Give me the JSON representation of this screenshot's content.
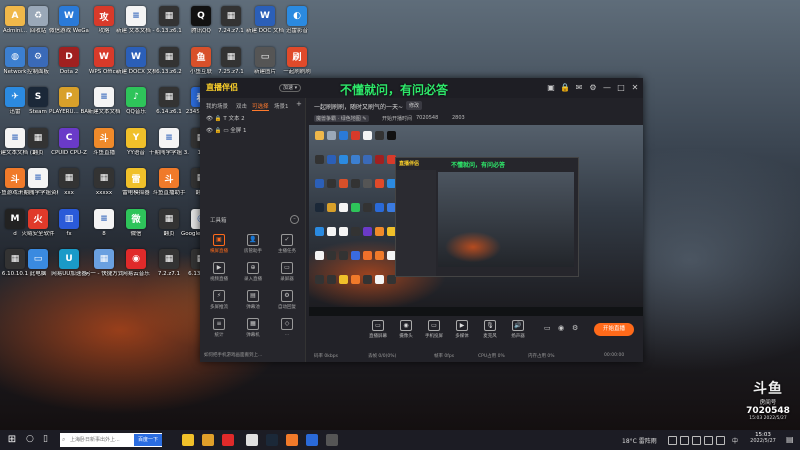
{
  "desktop": {
    "icons": [
      {
        "label": "Admini...",
        "color": "#f0b84a",
        "glyph": "A"
      },
      {
        "label": "回收站",
        "color": "#9aa8b8",
        "glyph": "♻"
      },
      {
        "label": "微信游戏\nWeGame版",
        "color": "#2a7ad8",
        "glyph": "W"
      },
      {
        "label": "攻略",
        "color": "#d83a2a",
        "glyph": "攻"
      },
      {
        "label": "新建 文本文档 - 副本",
        "color": "#f4f4f4",
        "glyph": "≡"
      },
      {
        "label": "6.13.z6.1",
        "color": "#333",
        "glyph": "▦"
      },
      {
        "label": "腾讯QQ",
        "color": "#111",
        "glyph": "Q"
      },
      {
        "label": "7.24.z7.1",
        "color": "#333",
        "glyph": "▦"
      },
      {
        "label": "新建 DOC 文档",
        "color": "#2b5fb8",
        "glyph": "W"
      },
      {
        "label": "迅雷影音",
        "color": "#2b8ae0",
        "glyph": "◐"
      },
      {
        "label": "Network",
        "color": "#3c7fd0",
        "glyph": "◍"
      },
      {
        "label": "控制面板",
        "color": "#3a6ab8",
        "glyph": "⚙"
      },
      {
        "label": "Dota 2",
        "color": "#a02020",
        "glyph": "D"
      },
      {
        "label": "WPS Office",
        "color": "#d83a2a",
        "glyph": "W"
      },
      {
        "label": "新建 DOCX 文档",
        "color": "#2b5fb8",
        "glyph": "W"
      },
      {
        "label": "6.13.z6.2",
        "color": "#333",
        "glyph": "▦"
      },
      {
        "label": "小鱼互联",
        "color": "#d8502a",
        "glyph": "鱼"
      },
      {
        "label": "7.25.z7.1",
        "color": "#333",
        "glyph": "▦"
      },
      {
        "label": "新建图片",
        "color": "#555",
        "glyph": "▭"
      },
      {
        "label": "一起刷刷刷",
        "color": "#e04a2a",
        "glyph": "刷"
      },
      {
        "label": "迅雷",
        "color": "#2b8ae0",
        "glyph": "✈"
      },
      {
        "label": "Steam",
        "color": "#1b2838",
        "glyph": "S"
      },
      {
        "label": "PLAYERU... BATTLEGR...",
        "color": "#d8a02a",
        "glyph": "P"
      },
      {
        "label": "新建文本文档",
        "color": "#f4f4f4",
        "glyph": "≡"
      },
      {
        "label": "QQ音乐",
        "color": "#2ec45a",
        "glyph": "♪"
      },
      {
        "label": "6.14.z6.1",
        "color": "#333",
        "glyph": "▦"
      },
      {
        "label": "2345看图王",
        "color": "#2a6ad8",
        "glyph": "看"
      },
      {
        "label": "斗鱼直播伴侣",
        "color": "#3a7ae0",
        "glyph": "斗"
      },
      {
        "label": "QQ游戏",
        "color": "#2a8ae0",
        "glyph": "游"
      },
      {
        "label": "十期闯学学姐",
        "color": "#f4f4f4",
        "glyph": "≡"
      },
      {
        "label": "新建文本文档 (2)",
        "color": "#f4f4f4",
        "glyph": "≡"
      },
      {
        "label": "翻页",
        "color": "#333",
        "glyph": "▦"
      },
      {
        "label": "CPUID CPU-Z",
        "color": "#6a3ac8",
        "glyph": "C"
      },
      {
        "label": "斗鱼直播",
        "color": "#f08a2a",
        "glyph": "斗"
      },
      {
        "label": "YY语音",
        "color": "#f0c02a",
        "glyph": "Y"
      },
      {
        "label": "十期闯学学姐 3.15日期表",
        "color": "#f4f4f4",
        "glyph": "≡"
      },
      {
        "label": "10",
        "color": "#333",
        "glyph": "▦"
      },
      {
        "label": "翻页",
        "color": "#333",
        "glyph": "▦"
      },
      {
        "label": "雷电多开器",
        "color": "#3a6ae0",
        "glyph": "雷"
      },
      {
        "label": "斗鱼直播伴侣",
        "color": "#f0702a",
        "glyph": "斗"
      },
      {
        "label": "斗鱼游戏浏览器",
        "color": "#f07a2a",
        "glyph": "斗"
      },
      {
        "label": "十期闯学学姐资料",
        "color": "#f4f4f4",
        "glyph": "≡"
      },
      {
        "label": "xxx",
        "color": "#333",
        "glyph": "▦"
      },
      {
        "label": "xxxxx",
        "color": "#333",
        "glyph": "▦"
      },
      {
        "label": "雷电模拟器",
        "color": "#f0c02a",
        "glyph": "雷"
      },
      {
        "label": "斗鱼直播助手",
        "color": "#f07a2a",
        "glyph": "斗"
      },
      {
        "label": "翻页",
        "color": "#333",
        "glyph": "▦"
      },
      {
        "label": "资源",
        "color": "#f4f4f4",
        "glyph": "≡"
      },
      {
        "label": "xl",
        "color": "#333",
        "glyph": "▦"
      },
      {
        "label": "翻页",
        "color": "#333",
        "glyph": "▦"
      },
      {
        "label": "d",
        "color": "#222",
        "glyph": "M"
      },
      {
        "label": "火绒安全软件",
        "color": "#e03a2a",
        "glyph": "火"
      },
      {
        "label": "fx",
        "color": "#2a5ad8",
        "glyph": "▥"
      },
      {
        "label": "8",
        "color": "#f4f4f4",
        "glyph": "≡"
      },
      {
        "label": "微信",
        "color": "#2ec45a",
        "glyph": "微"
      },
      {
        "label": "翻页",
        "color": "#333",
        "glyph": "▦"
      },
      {
        "label": "Google Chrome",
        "color": "#e0e0e0",
        "glyph": "◎"
      },
      {
        "label": "魔兽争霸官方对战平台",
        "color": "#2a4ad8",
        "glyph": "魔"
      },
      {
        "label": "赛博朋克 2077",
        "color": "#f0e02a",
        "glyph": "C"
      },
      {
        "label": "新建文本文档",
        "color": "#f4f4f4",
        "glyph": "≡"
      },
      {
        "label": "6.10.10.1",
        "color": "#333",
        "glyph": "▦"
      },
      {
        "label": "此电脑",
        "color": "#3a8ae0",
        "glyph": "▭"
      },
      {
        "label": "网易UU加速器",
        "color": "#1a9ac8",
        "glyph": "U"
      },
      {
        "label": "另一 - 快捷方式",
        "color": "#6aa0e0",
        "glyph": "▦"
      },
      {
        "label": "网易云音乐",
        "color": "#e02a2a",
        "glyph": "◉"
      },
      {
        "label": "7.2.z7.1",
        "color": "#333",
        "glyph": "▦"
      },
      {
        "label": "6.13.z6.1",
        "color": "#333",
        "glyph": "▦"
      },
      {
        "label": "b.2/9.z6",
        "color": "#333",
        "glyph": "▦"
      }
    ]
  },
  "app": {
    "logo": "直播伴侣",
    "logo_badge": "加速 ▾",
    "overlay_title": "不懂就问，有问必答",
    "window_controls": {
      "min": "—",
      "max": "□",
      "close": "✕",
      "settings": "⚙",
      "mail": "✉",
      "shirt": "▣",
      "lock": "🔒"
    },
    "sidebar": {
      "tabs": [
        "我的场景",
        "双击",
        "可选择",
        "场景1",
        "+"
      ],
      "active_tab": 2,
      "scenes": [
        {
          "label": "文本 2",
          "icons": "👁 🔒 T"
        },
        {
          "label": "全屏 1",
          "icons": "👁 🔒 ▭"
        }
      ],
      "tools_heading": "工具箱",
      "tools": [
        {
          "label": "横屏直播",
          "icon": "▣",
          "active": true
        },
        {
          "label": "房管助手",
          "icon": "👤"
        },
        {
          "label": "主播任务",
          "icon": "✓"
        },
        {
          "label": "视频直播",
          "icon": "▶"
        },
        {
          "label": "录入直播",
          "icon": "⊕"
        },
        {
          "label": "录屏器",
          "icon": "▭"
        },
        {
          "label": "多屏推流",
          "icon": "⚡"
        },
        {
          "label": "弹幕池",
          "icon": "▤"
        },
        {
          "label": "自动回复",
          "icon": "⚙"
        },
        {
          "label": "统计",
          "icon": "≡"
        },
        {
          "label": "弹幕机",
          "icon": "▦"
        },
        {
          "label": "...",
          "icon": "◇"
        }
      ],
      "tip": "如何把手机游戏画面搬到上..."
    },
    "room": {
      "title": "一起刷刷刷，随时又刷气的一天~",
      "edit_label": "修改",
      "info": [
        "魔兽争霸 · 绿色地图 ✎",
        "开始开播时间",
        "7020548",
        "2803"
      ]
    },
    "inner": {
      "title": "不懂就问，有问必答",
      "logo": "直播伴侣"
    },
    "bottom_tools": [
      {
        "label": "直播屏幕",
        "icon": "▭"
      },
      {
        "label": "摄像头",
        "icon": "◉"
      },
      {
        "label": "手机投屏",
        "icon": "▭"
      },
      {
        "label": "多媒体",
        "icon": "▶"
      },
      {
        "label": "麦克风",
        "icon": "🎙"
      },
      {
        "label": "扬声器",
        "icon": "🔊"
      }
    ],
    "right_icons": {
      "record": "▭",
      "eye": "◉",
      "settings": "⚙"
    },
    "start_live": "开始直播",
    "status": [
      "码率 0kbps",
      "丢帧 0/0(0%)",
      "帧率 0fps",
      "CPU占用 0%",
      "内存占用 0%",
      "00:00:00"
    ]
  },
  "watermark": {
    "logo": "斗鱼",
    "label": "房间号",
    "room": "7020548",
    "date": "15:03 2022/5/27"
  },
  "taskbar": {
    "search_placeholder": "上海卧日新事出外上...",
    "search_button": "百度一下",
    "weather": "18°C 雷阵雨",
    "ime": "中",
    "time": "15:03",
    "date": "2022/5/27",
    "apps": [
      {
        "name": "file-explorer-icon",
        "color": "#f0c02a"
      },
      {
        "name": "folder-icon",
        "color": "#e0a02a"
      },
      {
        "name": "netease-music-icon",
        "color": "#e02a2a"
      },
      {
        "name": "chrome-icon",
        "color": "#e0e0e0"
      },
      {
        "name": "steam-icon",
        "color": "#1b2838"
      },
      {
        "name": "douyu-companion-icon",
        "color": "#f07a2a"
      },
      {
        "name": "browser-icon",
        "color": "#2a6ad8"
      },
      {
        "name": "app-icon",
        "color": "#555"
      }
    ]
  }
}
